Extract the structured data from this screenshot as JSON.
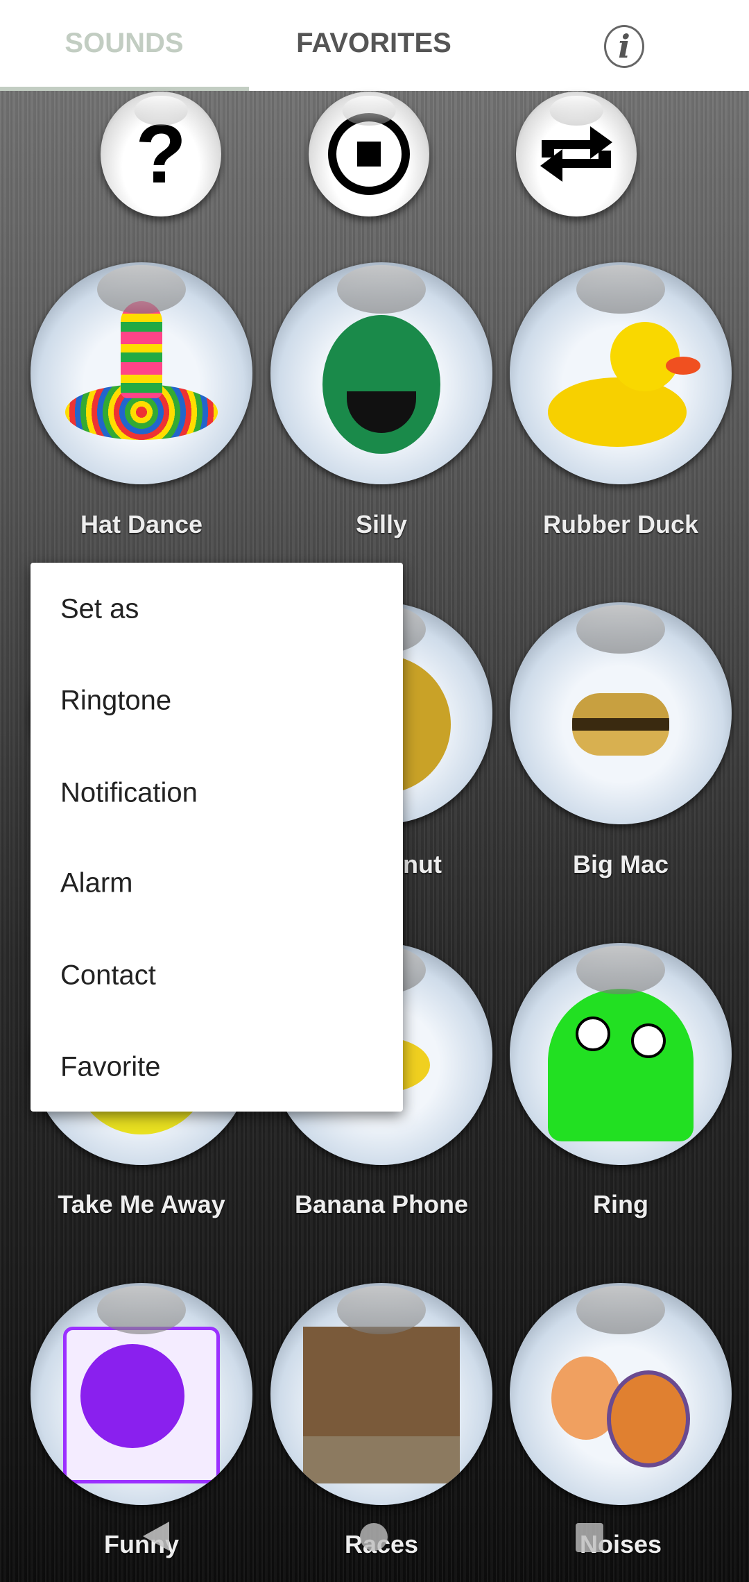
{
  "tabs": [
    {
      "label": "SOUNDS",
      "active": true,
      "color": "#c2cdc2"
    },
    {
      "label": "FAVORITES",
      "active": false,
      "color": "#555555"
    }
  ],
  "info_icon": "info-icon",
  "controls": [
    {
      "name": "help",
      "icon": "question-mark-icon",
      "glyph": "?"
    },
    {
      "name": "stop",
      "icon": "stop-icon"
    },
    {
      "name": "repeat",
      "icon": "repeat-icon"
    }
  ],
  "sounds": [
    {
      "label": "Hat Dance",
      "icon": "sombrero"
    },
    {
      "label": "Silly",
      "icon": "green-monster"
    },
    {
      "label": "Rubber Duck",
      "icon": "rubber-duck"
    },
    {
      "label": "",
      "icon": "hidden"
    },
    {
      "label": "nut",
      "icon": "yellow-face"
    },
    {
      "label": "Big Mac",
      "icon": "burger-chef"
    },
    {
      "label": "Take Me Away",
      "icon": "yellow-circle"
    },
    {
      "label": "Banana Phone",
      "icon": "banana"
    },
    {
      "label": "Ring",
      "icon": "green-ghost"
    },
    {
      "label": "Funny",
      "icon": "turntable"
    },
    {
      "label": "Races",
      "icon": "horse"
    },
    {
      "label": "Noises",
      "icon": "drums"
    }
  ],
  "context_menu": {
    "items": [
      "Set as",
      "Ringtone",
      "Notification",
      "Alarm",
      "Contact",
      "Favorite"
    ]
  },
  "nav": [
    "back",
    "home",
    "recents"
  ]
}
